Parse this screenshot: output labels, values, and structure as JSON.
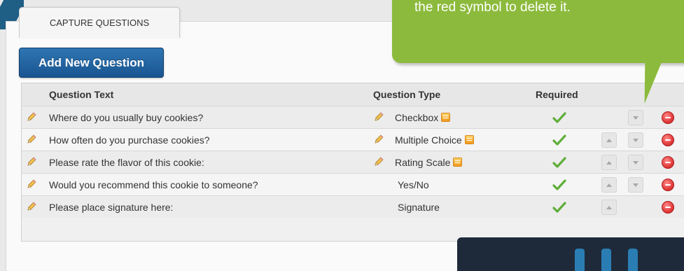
{
  "tab": {
    "label": "CAPTURE QUESTIONS"
  },
  "add_button": {
    "label": "Add New Question"
  },
  "table": {
    "columns": {
      "text": "Question Text",
      "type": "Question Type",
      "required": "Required"
    },
    "rows": [
      {
        "text": "Where do you usually buy cookies?",
        "type": "Checkbox",
        "editable_type": true,
        "required": true,
        "up": false,
        "down": true
      },
      {
        "text": "How often do you purchase cookies?",
        "type": "Multiple Choice",
        "editable_type": true,
        "required": true,
        "up": true,
        "down": true
      },
      {
        "text": "Please rate the flavor of this cookie:",
        "type": "Rating Scale",
        "editable_type": true,
        "required": true,
        "up": true,
        "down": true
      },
      {
        "text": "Would you recommend this cookie to someone?",
        "type": "Yes/No",
        "editable_type": false,
        "required": true,
        "up": true,
        "down": true
      },
      {
        "text": "Please place signature here:",
        "type": "Signature",
        "editable_type": false,
        "required": true,
        "up": true,
        "down": false
      }
    ]
  },
  "callout": {
    "text": "the red symbol to delete it."
  },
  "colors": {
    "accent_blue": "#1a5591",
    "callout_green": "#8cba3c",
    "delete_red": "#e23b3b"
  },
  "icons": {
    "edit": "pencil-icon",
    "check": "checkmark-icon",
    "delete": "delete-icon",
    "config": "settings-badge-icon"
  }
}
